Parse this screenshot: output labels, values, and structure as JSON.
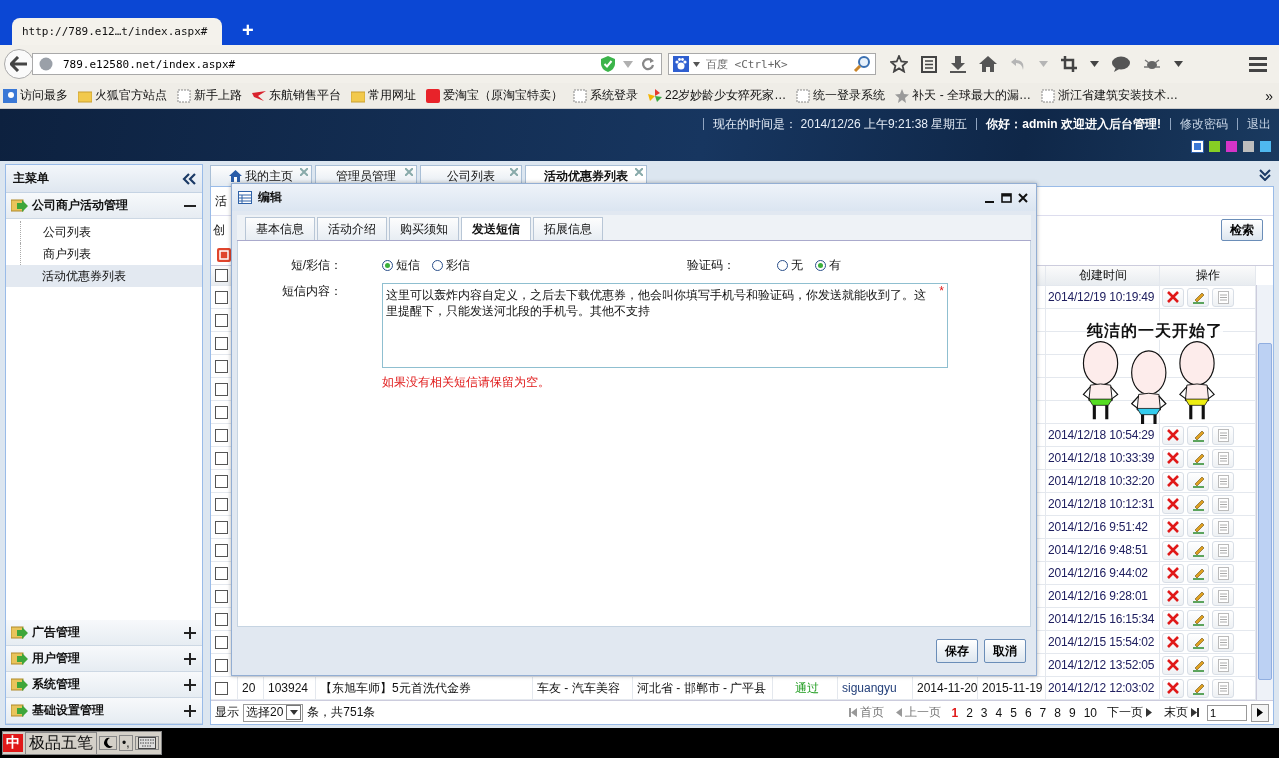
{
  "browser": {
    "tab_title": "http://789.e12…t/index.aspx#",
    "new_tab": "+",
    "url": "789.e12580.net/index.aspx#",
    "search_placeholder": "百度 <Ctrl+K>",
    "bookmarks": [
      {
        "label": "访问最多",
        "kind": "search"
      },
      {
        "label": "火狐官方站点",
        "kind": "folder"
      },
      {
        "label": "新手上路",
        "kind": "blank"
      },
      {
        "label": "东航销售平台",
        "kind": "bird"
      },
      {
        "label": "常用网址",
        "kind": "folder"
      },
      {
        "label": "爱淘宝（原淘宝特卖）",
        "kind": "redsquare"
      },
      {
        "label": "系统登录",
        "kind": "blank"
      },
      {
        "label": "22岁妙龄少女猝死家…",
        "kind": "pinwheel"
      },
      {
        "label": "统一登录系统",
        "kind": "blank"
      },
      {
        "label": "补天 - 全球最大的漏…",
        "kind": "star"
      },
      {
        "label": "浙江省建筑安装技术…",
        "kind": "blank"
      }
    ],
    "bookmarks_more": "»"
  },
  "header": {
    "time": "现在的时间是： 2014/12/26 上午9:21:38 星期五",
    "greeting": "你好：admin 欢迎进入后台管理!",
    "links": [
      "修改密码",
      "退出"
    ],
    "themes": [
      {
        "color": "#3a78d6",
        "selected": true
      },
      {
        "color": "#86cf24",
        "selected": false
      },
      {
        "color": "#d634c8",
        "selected": false
      },
      {
        "color": "#bdbdbd",
        "selected": false
      },
      {
        "color": "#4fb8ef",
        "selected": false
      }
    ]
  },
  "sidebar": {
    "title": "主菜单",
    "groups": [
      {
        "label": "公司商户活动管理",
        "expanded": true,
        "items": [
          {
            "label": "公司列表",
            "selected": false
          },
          {
            "label": "商户列表",
            "selected": false
          },
          {
            "label": "活动优惠券列表",
            "selected": true
          }
        ]
      },
      {
        "label": "广告管理",
        "expanded": false
      },
      {
        "label": "用户管理",
        "expanded": false
      },
      {
        "label": "系统管理",
        "expanded": false
      },
      {
        "label": "基础设置管理",
        "expanded": false
      }
    ]
  },
  "tabs": [
    {
      "label": "我的主页",
      "home": true,
      "selected": false
    },
    {
      "label": "管理员管理",
      "home": false,
      "selected": false
    },
    {
      "label": "公司列表",
      "home": false,
      "selected": false
    },
    {
      "label": "活动优惠券列表",
      "home": false,
      "selected": true
    }
  ],
  "page": {
    "title_fragment": "活",
    "toolbar_fragment": "创",
    "search_button": "检索"
  },
  "table": {
    "columns": [
      "创建时间",
      "操作"
    ],
    "all_checked": false,
    "rows": [
      {
        "checked": false,
        "created": "2014/12/19 10:19:49"
      },
      {
        "checked": false
      },
      {
        "checked": false
      },
      {
        "checked": false
      },
      {
        "checked": false
      },
      {
        "checked": false
      },
      {
        "checked": false,
        "created": "2014/12/18 10:54:29"
      },
      {
        "checked": false,
        "created": "2014/12/18 10:33:39"
      },
      {
        "checked": false,
        "created": "2014/12/18 10:32:20"
      },
      {
        "checked": false,
        "created": "2014/12/18 10:12:31"
      },
      {
        "checked": false,
        "created": "2014/12/16 9:51:42"
      },
      {
        "checked": false,
        "created": "2014/12/16 9:48:51"
      },
      {
        "checked": false,
        "created": "2014/12/16 9:44:02"
      },
      {
        "checked": false,
        "created": "2014/12/16 9:28:01"
      },
      {
        "checked": false,
        "created": "2014/12/15 16:15:34"
      },
      {
        "checked": false,
        "created": "2014/12/15 15:54:02"
      },
      {
        "checked": false,
        "created": "2014/12/12 13:52:05"
      },
      {
        "checked": false,
        "index": "20",
        "id": "103924",
        "name": "【东旭车师】5元首洗代金券",
        "category": "车友 - 汽车美容",
        "region": "河北省 - 邯郸市 - 广平县",
        "status": "通过",
        "user": "siguangyu",
        "start": "2014-11-20",
        "end": "2015-11-19",
        "created": "2014/12/12 12:03:02"
      }
    ]
  },
  "pager": {
    "show_label": "显示",
    "page_size": "选择20",
    "total": "条，共751条",
    "first": "首页",
    "prev": "上一页",
    "pages": [
      {
        "label": "1",
        "selected": true
      },
      {
        "label": "2",
        "selected": false
      },
      {
        "label": "3",
        "selected": false
      },
      {
        "label": "4",
        "selected": false
      },
      {
        "label": "5",
        "selected": false
      },
      {
        "label": "6",
        "selected": false
      },
      {
        "label": "7",
        "selected": false
      },
      {
        "label": "8",
        "selected": false
      },
      {
        "label": "9",
        "selected": false
      },
      {
        "label": "10",
        "selected": false
      }
    ],
    "next": "下一页",
    "last": "末页",
    "page_input": "1"
  },
  "dialog": {
    "title": "编辑",
    "tabs": [
      {
        "label": "基本信息",
        "selected": false
      },
      {
        "label": "活动介绍",
        "selected": false
      },
      {
        "label": "购买须知",
        "selected": false
      },
      {
        "label": "发送短信",
        "selected": true
      },
      {
        "label": "拓展信息",
        "selected": false
      }
    ],
    "sms_type_label": "短/彩信：",
    "sms_types": [
      {
        "label": "短信",
        "selected": true
      },
      {
        "label": "彩信",
        "selected": false
      }
    ],
    "captcha_label": "验证码：",
    "captcha": [
      {
        "label": "无",
        "selected": false
      },
      {
        "label": "有",
        "selected": true
      }
    ],
    "content_label": "短信内容：",
    "content": "这里可以轰炸内容自定义，之后去下载优惠券，他会叫你填写手机号和验证码，你发送就能收到了。这里提醒下，只能发送河北段的手机号。其他不支持",
    "required": "*",
    "hint": "如果没有相关短信请保留为空。",
    "buttons": [
      "保存",
      "取消"
    ]
  },
  "sticker": {
    "caption": "纯洁的一天开始了"
  },
  "taskbar": {
    "ime_mark": "中",
    "ime_name": "极品五笔",
    "punct": "•,"
  }
}
